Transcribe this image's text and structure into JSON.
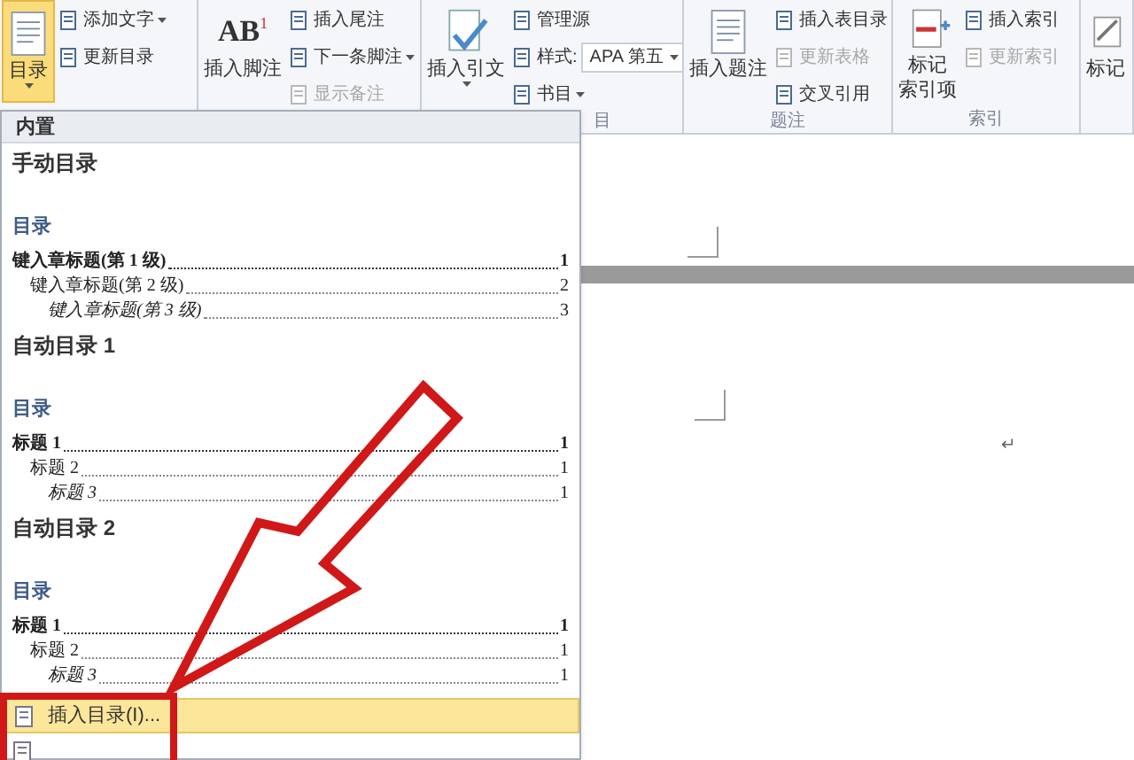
{
  "ribbon": {
    "groups": [
      {
        "big": {
          "lines": [
            "目录"
          ],
          "caret": true,
          "selected": true
        },
        "small": [
          {
            "label": "添加文字",
            "kind": "button",
            "caret": true,
            "disabled": false
          },
          {
            "label": "更新目录",
            "kind": "button",
            "caret": false,
            "disabled": false
          }
        ]
      },
      {
        "big": {
          "lines": [
            "插入脚注"
          ],
          "icon_text": "AB",
          "icon_superscript": "1",
          "caret": false,
          "selected": false
        },
        "small": [
          {
            "label": "插入尾注",
            "kind": "button",
            "caret": false,
            "disabled": false
          },
          {
            "label": "下一条脚注",
            "kind": "button",
            "caret": true,
            "disabled": false
          },
          {
            "label": "显示备注",
            "kind": "button",
            "caret": false,
            "disabled": true
          }
        ]
      },
      {
        "label": "目",
        "big": {
          "lines": [
            "插入引文"
          ],
          "caret": true,
          "selected": false
        },
        "small": [
          {
            "label": "管理源",
            "kind": "button",
            "caret": false,
            "disabled": false
          },
          {
            "label": "样式:",
            "kind": "combo",
            "value": "APA 第五",
            "caret": true,
            "disabled": false
          },
          {
            "label": "书目",
            "kind": "button",
            "caret": true,
            "disabled": false
          }
        ]
      },
      {
        "label": "题注",
        "big": {
          "lines": [
            "插入题注"
          ],
          "caret": false,
          "selected": false
        },
        "small": [
          {
            "label": "插入表目录",
            "kind": "button",
            "caret": false,
            "disabled": false
          },
          {
            "label": "更新表格",
            "kind": "button",
            "caret": false,
            "disabled": true
          },
          {
            "label": "交叉引用",
            "kind": "button",
            "caret": false,
            "disabled": false
          }
        ]
      },
      {
        "label": "索引",
        "big": {
          "lines": [
            "标记",
            "索引项"
          ],
          "caret": false,
          "selected": false
        },
        "small": [
          {
            "label": "插入索引",
            "kind": "button",
            "caret": false,
            "disabled": false
          },
          {
            "label": "更新索引",
            "kind": "button",
            "caret": false,
            "disabled": true
          }
        ]
      },
      {
        "big": {
          "lines": [
            "标记"
          ],
          "caret": false,
          "selected": false
        }
      }
    ]
  },
  "document": {
    "paragraph_mark": "↵"
  },
  "toc_menu": {
    "header": "内置",
    "galleries": [
      {
        "title": "手动目录",
        "heading": "目录",
        "entries": [
          {
            "text": "键入章标题(第 1 级)",
            "page": "1",
            "children": [
              {
                "text": "键入章标题(第 2 级)",
                "page": "2",
                "children": [
                  {
                    "text": "键入章标题(第 3 级)",
                    "page": "3"
                  }
                ]
              }
            ]
          }
        ]
      },
      {
        "title": "自动目录 1",
        "heading": "目录",
        "entries": [
          {
            "text": "标题 1",
            "page": "1",
            "children": [
              {
                "text": "标题 2",
                "page": "1",
                "children": [
                  {
                    "text": "标题 3",
                    "page": "1"
                  }
                ]
              }
            ]
          }
        ]
      },
      {
        "title": "自动目录 2",
        "heading": "目录",
        "entries": [
          {
            "text": "标题 1",
            "page": "1",
            "children": [
              {
                "text": "标题 2",
                "page": "1",
                "children": [
                  {
                    "text": "标题 3",
                    "page": "1"
                  }
                ]
              }
            ]
          }
        ]
      }
    ],
    "items": [
      {
        "label": "插入目录(I)...",
        "selected": true
      },
      {
        "selected": false
      }
    ]
  }
}
